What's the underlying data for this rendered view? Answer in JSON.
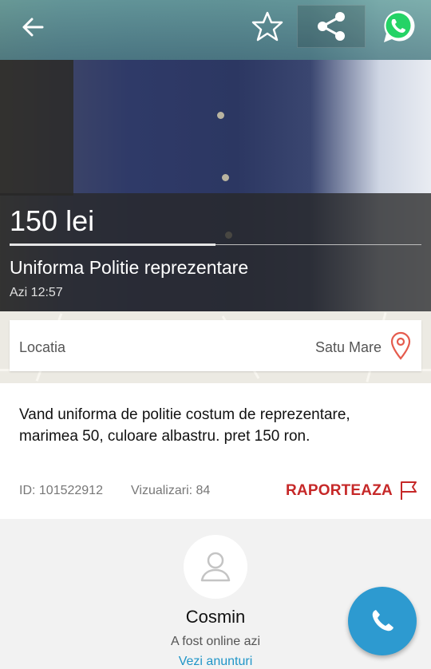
{
  "listing": {
    "price": "150 lei",
    "title": "Uniforma Politie reprezentare",
    "posted": "Azi 12:57",
    "location_label": "Locatia",
    "location_value": "Satu Mare",
    "description": "Vand uniforma de politie costum de reprezentare, marimea 50, culoare albastru. pret 150 ron.",
    "id_text": "ID: 101522912",
    "views_text": "Vizualizari: 84",
    "report_label": "RAPORTEAZA",
    "photo_progress": 0.5
  },
  "seller": {
    "name": "Cosmin",
    "status": "A fost online azi",
    "ads_link": "Vezi anunturi"
  },
  "icons": {
    "back": "arrow-left-icon",
    "favorite": "star-outline-icon",
    "share": "share-icon",
    "whatsapp": "whatsapp-icon",
    "location": "map-pin-icon",
    "report": "flag-icon",
    "avatar": "user-icon",
    "call": "phone-icon"
  },
  "colors": {
    "report": "#c62828",
    "link": "#2196c8",
    "call_button": "#2d9ad0",
    "whatsapp": "#25d366"
  }
}
